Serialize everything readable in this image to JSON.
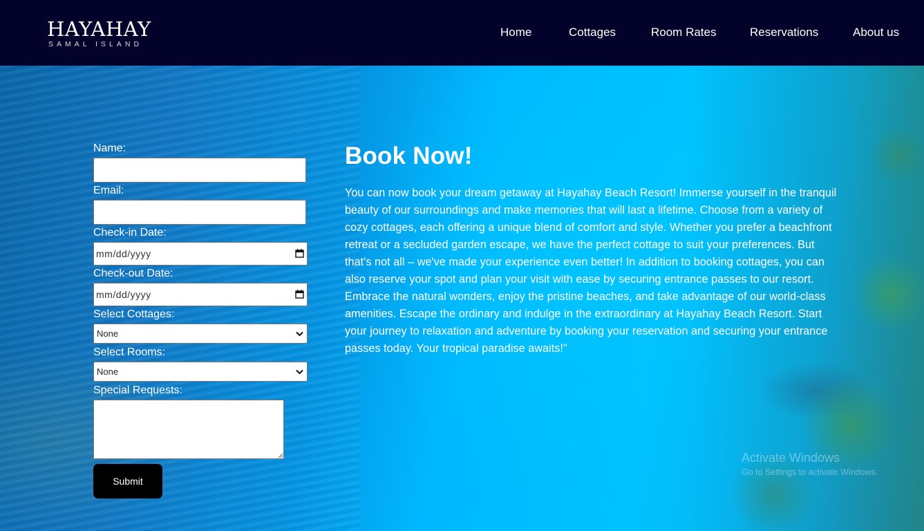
{
  "brand": {
    "name": "HAYAHAY",
    "tagline": "SAMAL ISLAND"
  },
  "nav": {
    "items": [
      {
        "label": "Home"
      },
      {
        "label": "Cottages"
      },
      {
        "label": "Room Rates"
      },
      {
        "label": "Reservations"
      },
      {
        "label": "About us"
      }
    ]
  },
  "form": {
    "name_label": "Name:",
    "name_value": "",
    "email_label": "Email:",
    "email_value": "",
    "checkin_label": "Check-in Date:",
    "checkin_value": "mm/dd/yyyy",
    "checkout_label": "Check-out Date:",
    "checkout_value": "mm/dd/yyyy",
    "cottages_label": "Select Cottages:",
    "cottages_value": "None",
    "rooms_label": "Select Rooms:",
    "rooms_value": "None",
    "requests_label": "Special Requests:",
    "requests_value": "",
    "submit_label": "Submit"
  },
  "content": {
    "heading": "Book Now!",
    "description": "You can now book your dream getaway at Hayahay Beach Resort! Immerse yourself in the tranquil beauty of our surroundings and make memories that will last a lifetime. Choose from a variety of cozy cottages, each offering a unique blend of comfort and style. Whether you prefer a beachfront retreat or a secluded garden escape, we have the perfect cottage to suit your preferences. But that's not all – we've made your experience even better! In addition to booking cottages, you can also reserve your spot and plan your visit with ease by securing entrance passes to our resort. Embrace the natural wonders, enjoy the pristine beaches, and take advantage of our world-class amenities. Escape the ordinary and indulge in the extraordinary at Hayahay Beach Resort. Start your journey to relaxation and adventure by booking your reservation and securing your entrance passes today. Your tropical paradise awaits!\""
  },
  "watermark": {
    "title": "Activate Windows",
    "subtitle": "Go to Settings to activate Windows."
  },
  "colors": {
    "navbar": "#03022a",
    "hero": "#00bfff",
    "button": "#000000",
    "text": "#ffffff"
  },
  "icons": {
    "date": "calendar-icon",
    "select": "chevron-down-icon",
    "textarea": "resize-handle-icon"
  }
}
